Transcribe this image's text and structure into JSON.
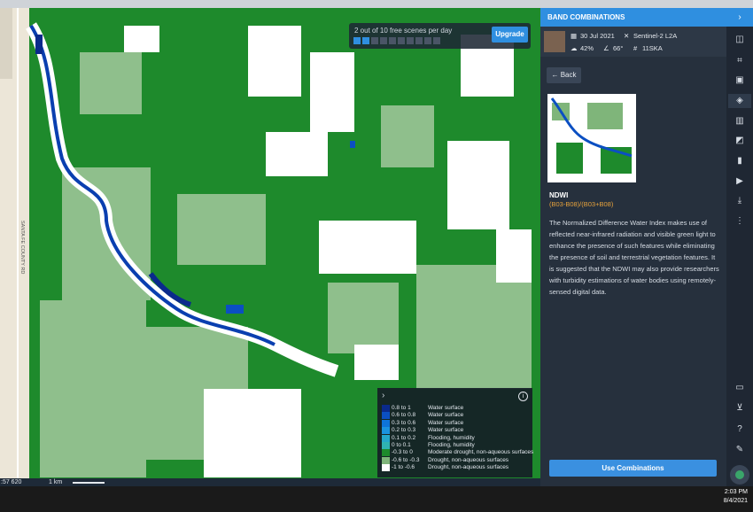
{
  "map": {
    "scene_info": "2 out of 10 free scenes per day",
    "scenes_used": 2,
    "scenes_total": 10,
    "upgrade_label": "Upgrade",
    "road_label": "SANTA FE COUNTY RD",
    "coordinate": ":57 620",
    "scale_label": "1 km",
    "colors": {
      "vegetation": "#1e8a2c",
      "light_vegetation": "#8fbf8c",
      "water": "#0a3fb0",
      "accent": "#2f8fe0"
    }
  },
  "legend": {
    "items": [
      {
        "range": "0.8 to 1",
        "desc": "Water surface",
        "color": "#0a2a8c"
      },
      {
        "range": "0.6 to 0.8",
        "desc": "Water surface",
        "color": "#0b4fc2"
      },
      {
        "range": "0.3 to 0.6",
        "desc": "Water surface",
        "color": "#0e74d8"
      },
      {
        "range": "0.2 to 0.3",
        "desc": "Water surface",
        "color": "#1a93de"
      },
      {
        "range": "0.1 to 0.2",
        "desc": "Flooding, humidity",
        "color": "#24a7c9"
      },
      {
        "range": "0 to 0.1",
        "desc": "Flooding, humidity",
        "color": "#2fb3b0"
      },
      {
        "range": "-0.3 to 0",
        "desc": "Moderate drought, non-aqueous surfaces",
        "color": "#1e8a2c"
      },
      {
        "range": "-0.6 to -0.3",
        "desc": "Drought, non-aqueous surfaces",
        "color": "#7fb57a"
      },
      {
        "range": "-1 to -0.6",
        "desc": "Drought, non-aqueous surfaces",
        "color": "#ffffff"
      }
    ]
  },
  "panel": {
    "title": "BAND COMBINATIONS",
    "date": "30 Jul 2021",
    "satellite": "Sentinel-2 L2A",
    "cloud": "42%",
    "angle": "66°",
    "tile": "11SKA",
    "back_label": "Back",
    "index_name": "NDWI",
    "formula": "(B03-B08)/(B03+B08)",
    "description": "The Normalized Difference Water Index makes use of reflected near-infrared radiation and visible green light to enhance the presence of such features while eliminating the presence of soil and terrestrial vegetation features. It is suggested that the NDWI may also provide researchers with turbidity estimations of water bodies using remotely-sensed digital data.",
    "use_button": "Use Combinations"
  },
  "taskbar": {
    "time": "2:03 PM",
    "date": "8/4/2021"
  }
}
